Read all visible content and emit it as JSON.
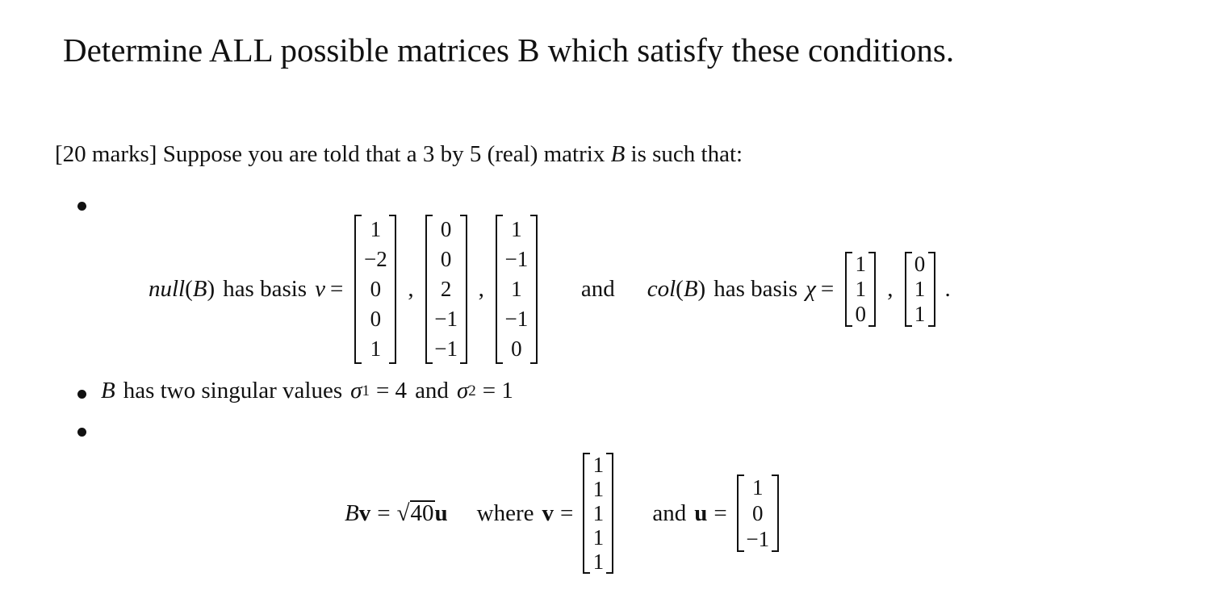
{
  "title": "Determine ALL possible matrices B which satisfy these conditions.",
  "intro": {
    "marks": "[20 marks]",
    "text": "Suppose you are told that a 3 by 5 (real) matrix",
    "var": "B",
    "tail": "is such that:"
  },
  "condition1": {
    "null_label": "null",
    "paren_open": "(",
    "B": "B",
    "paren_close": ")",
    "has_basis": "has basis",
    "nu": "ν",
    "equals": "=",
    "null_basis": [
      [
        "1",
        "−2",
        "0",
        "0",
        "1"
      ],
      [
        "0",
        "0",
        "2",
        "−1",
        "−1"
      ],
      [
        "1",
        "−1",
        "1",
        "−1",
        "0"
      ]
    ],
    "comma": ",",
    "and": "and",
    "col_label": "col",
    "chi": "χ",
    "col_basis": [
      [
        "1",
        "1",
        "0"
      ],
      [
        "0",
        "1",
        "1"
      ]
    ],
    "period": "."
  },
  "condition2": {
    "B": "B",
    "text": "has two singular values",
    "sigma": "σ",
    "sub1": "1",
    "eq4": "= 4",
    "and": "and",
    "sub2": "2",
    "eq1": "= 1"
  },
  "condition3": {
    "B": "B",
    "v_bold": "v",
    "equals": "=",
    "sqrt_sign": "√",
    "radicand": "40",
    "u_bold": "u",
    "where": "where",
    "v_vector": [
      "1",
      "1",
      "1",
      "1",
      "1"
    ],
    "and": "and",
    "u_vector": [
      "1",
      "0",
      "−1"
    ]
  }
}
